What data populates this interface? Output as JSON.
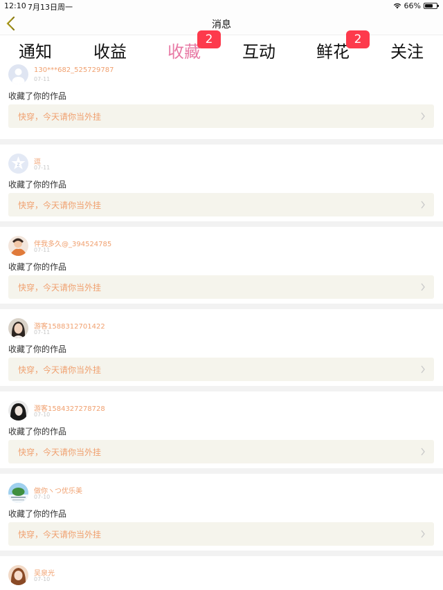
{
  "status_bar": {
    "time": "12:10",
    "date": "7月13日周一",
    "battery": "66%",
    "icons": [
      "wifi-icon",
      "battery-icon"
    ]
  },
  "nav": {
    "title": "消息",
    "back_icon": "chevron-left-icon"
  },
  "tabs": [
    {
      "label": "通知",
      "active": false
    },
    {
      "label": "收益",
      "active": false
    },
    {
      "label": "收藏",
      "active": true,
      "badge": "2"
    },
    {
      "label": "互动",
      "active": false
    },
    {
      "label": "鲜花",
      "active": false,
      "badge": "2"
    },
    {
      "label": "关注",
      "active": false
    }
  ],
  "notifications": [
    {
      "user": "130***682_525729787",
      "date": "07-11",
      "action": "收藏了你的作品",
      "work": "快穿，今天请你当外挂"
    },
    {
      "user": "逗",
      "date": "07-11",
      "action": "收藏了你的作品",
      "work": "快穿，今天请你当外挂"
    },
    {
      "user": "伴我多久@_394524785",
      "date": "07-11",
      "action": "收藏了你的作品",
      "work": "快穿，今天请你当外挂"
    },
    {
      "user": "游客1588312701422",
      "date": "07-11",
      "action": "收藏了你的作品",
      "work": "快穿，今天请你当外挂"
    },
    {
      "user": "游客1584327278728",
      "date": "07-10",
      "action": "收藏了你的作品",
      "work": "快穿，今天请你当外挂"
    },
    {
      "user": "做你ヽつ优乐美",
      "date": "07-10",
      "action": "收藏了你的作品",
      "work": "快穿，今天请你当外挂"
    },
    {
      "user": "吴泉光",
      "date": "07-10",
      "action": "",
      "work": ""
    }
  ],
  "colors": {
    "accent_pink": "#e87aa5",
    "badge_red": "#fd3a4c",
    "username_orange": "#f0a06f",
    "work_bg": "#f5f4ec"
  }
}
